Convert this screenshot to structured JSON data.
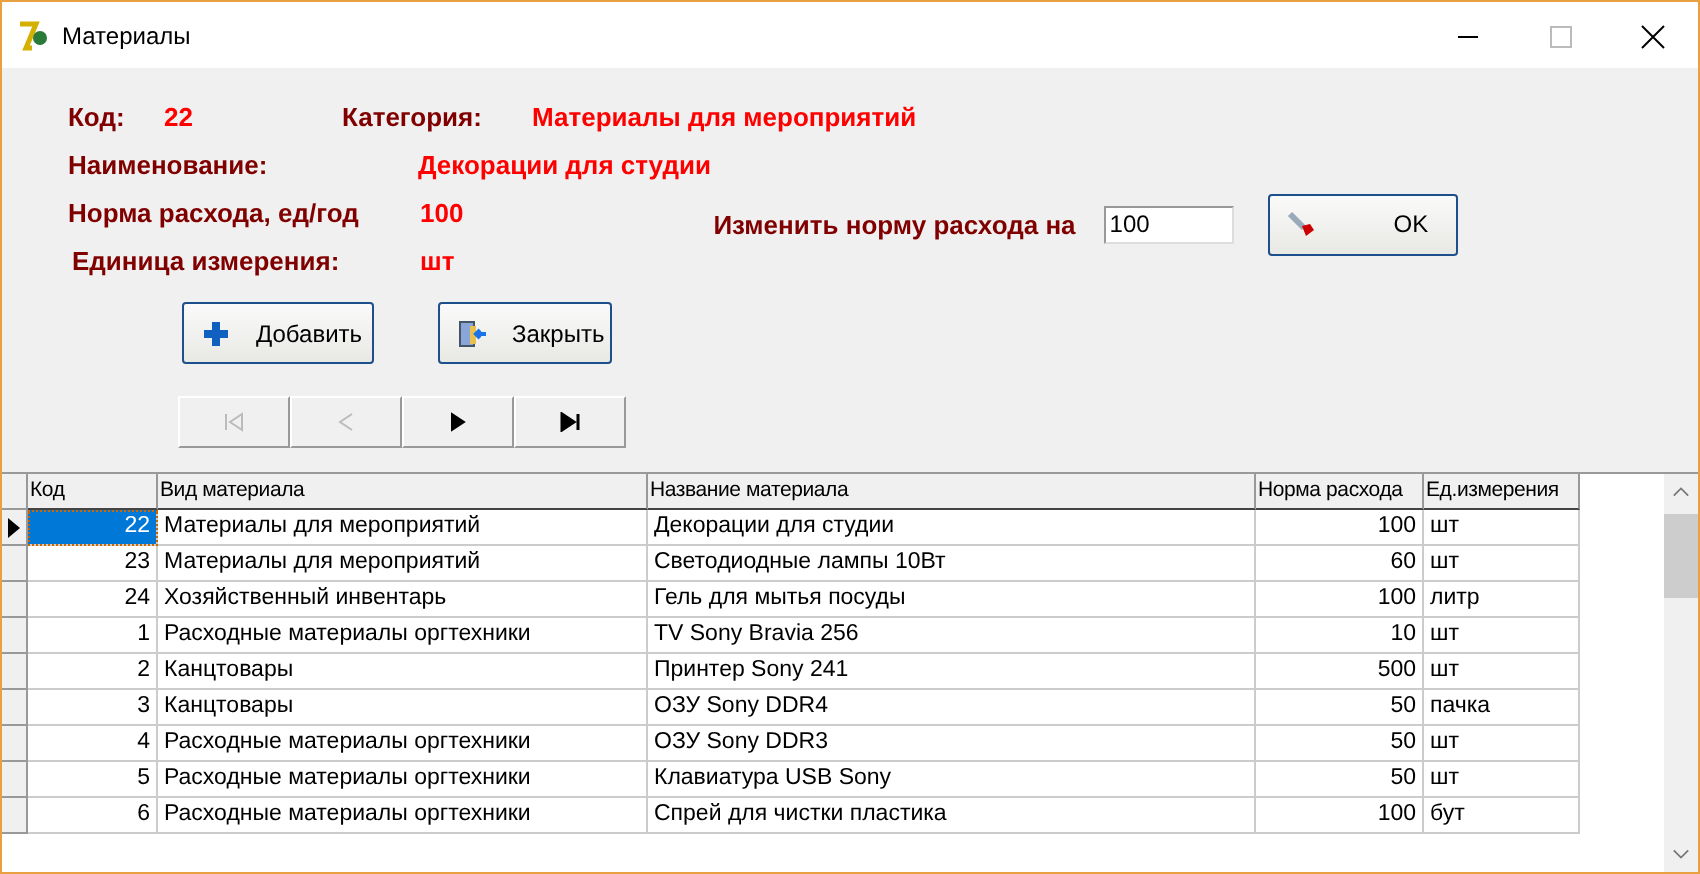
{
  "window": {
    "title": "Материалы"
  },
  "details": {
    "code_label": "Код:",
    "code": "22",
    "category_label": "Категория:",
    "category": "Материалы для мероприятий",
    "name_label": "Наименование:",
    "name": "Декорации для студии",
    "rate_label": "Норма расхода, ед/год",
    "rate": "100",
    "unit_label": "Единица измерения:",
    "unit": "шт"
  },
  "change_rate": {
    "label": "Изменить норму расхода на",
    "value": "100",
    "button": "OK"
  },
  "buttons": [
    {
      "kind": "add",
      "label": "Добавить"
    },
    {
      "kind": "close",
      "label": "Закрыть"
    }
  ],
  "navigator": [
    {
      "kind": "first",
      "disabled": true
    },
    {
      "kind": "prior",
      "disabled": true
    },
    {
      "kind": "next",
      "disabled": false
    },
    {
      "kind": "last",
      "disabled": false
    }
  ],
  "table": {
    "columns": [
      "Код",
      "Вид материала",
      "Название материала",
      "Норма расхода",
      "Ед.измерения"
    ],
    "rows": [
      {
        "selected": true,
        "cells": [
          "22",
          "Материалы для мероприятий",
          "Декорации для студии",
          "100",
          "шт"
        ]
      },
      {
        "selected": false,
        "cells": [
          "23",
          "Материалы для мероприятий",
          "Светодиодные лампы 10Вт",
          "60",
          "шт"
        ]
      },
      {
        "selected": false,
        "cells": [
          "24",
          "Хозяйственный инвентарь",
          "Гель для мытья посуды",
          "100",
          "литр"
        ]
      },
      {
        "selected": false,
        "cells": [
          "1",
          "Расходные материалы оргтехники",
          "TV Sony Bravia 256",
          "10",
          "шт"
        ]
      },
      {
        "selected": false,
        "cells": [
          "2",
          "Канцтовары",
          "Принтер Sony 241",
          "500",
          "шт"
        ]
      },
      {
        "selected": false,
        "cells": [
          "3",
          "Канцтовары",
          "ОЗУ Sony DDR4",
          "50",
          "пачка"
        ]
      },
      {
        "selected": false,
        "cells": [
          "4",
          "Расходные материалы оргтехники",
          "ОЗУ Sony DDR3",
          "50",
          "шт"
        ]
      },
      {
        "selected": false,
        "cells": [
          "5",
          "Расходные материалы оргтехники",
          "Клавиатура USB Sony",
          "50",
          "шт"
        ]
      },
      {
        "selected": false,
        "cells": [
          "6",
          "Расходные материалы оргтехники",
          "Спрей для чистки пластика",
          "100",
          "бут"
        ]
      }
    ]
  }
}
